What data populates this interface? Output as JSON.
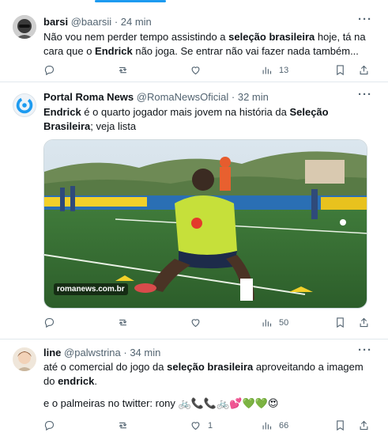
{
  "tweets": [
    {
      "name": "barsi",
      "handle": "@baarsii",
      "time": "· 24 min",
      "text_parts": [
        "Não vou nem perder tempo assistindo a ",
        "seleção brasileira",
        " hoje, tá na cara que o ",
        "Endrick",
        " não joga. Se entrar não vai fazer nada também..."
      ],
      "replies": "",
      "retweets": "",
      "likes": "",
      "views": "13"
    },
    {
      "name": "Portal Roma News",
      "handle": "@RomaNewsOficial",
      "time": "· 32 min",
      "text_parts": [
        "Endrick",
        " é o quarto jogador mais jovem na história da ",
        "Seleção Brasileira",
        "; veja lista"
      ],
      "media_watermark": "romanews.com.br",
      "replies": "",
      "retweets": "",
      "likes": "",
      "views": "50"
    },
    {
      "name": "line",
      "handle": "@palwstrina",
      "time": "· 34 min",
      "text_parts": [
        "até o comercial do jogo da ",
        "seleção brasileira",
        " aproveitando a imagem do ",
        "endrick",
        "."
      ],
      "text2": "e o palmeiras no twitter: rony 🚲📞📞🚲💕💚💚😍",
      "replies": "",
      "retweets": "",
      "likes": "1",
      "views": "66"
    }
  ],
  "icons": {
    "more": "more-icon",
    "reply": "reply-icon",
    "retweet": "retweet-icon",
    "like": "like-icon",
    "views": "views-icon",
    "bookmark": "bookmark-icon",
    "share": "share-icon"
  },
  "colors": {
    "accent": "#1d9bf0",
    "secondary_text": "#536471",
    "border": "#e1e8ed"
  }
}
